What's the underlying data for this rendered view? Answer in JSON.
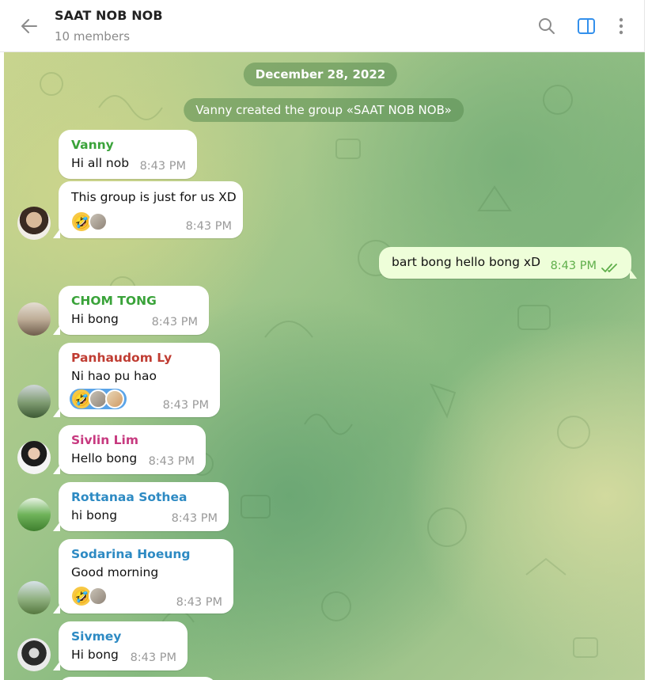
{
  "header": {
    "title": "SAAT NOB NOB",
    "subtitle": "10 members"
  },
  "chat": {
    "date_pill": "December 28, 2022",
    "service_message": "Vanny created the group «SAAT NOB NOB»",
    "messages": [
      {
        "sender": "Vanny",
        "sender_color": "#3aa33a",
        "text": "Hi all nob",
        "time": "8:43 PM"
      },
      {
        "sender": "",
        "text": "This group is just for us XD",
        "time": "8:43 PM",
        "reaction_emoji": "🤣"
      },
      {
        "sender": "",
        "text": "bart bong hello bong xD",
        "time": "8:43 PM",
        "outgoing": true
      },
      {
        "sender": "CHOM TONG",
        "sender_color": "#3aa33a",
        "text": "Hi bong",
        "time": "8:43 PM"
      },
      {
        "sender": "Panhaudom Ly",
        "sender_color": "#c03d33",
        "text": "Ni hao pu hao",
        "time": "8:43 PM",
        "reaction_emoji": "🤣"
      },
      {
        "sender": "Sivlin Lim",
        "sender_color": "#c7397f",
        "text": "Hello bong",
        "time": "8:43 PM"
      },
      {
        "sender": "Rottanaa Sothea",
        "sender_color": "#2d8ac3",
        "text": "hi bong",
        "time": "8:43 PM"
      },
      {
        "sender": "Sodarina Hoeung",
        "sender_color": "#2d8ac3",
        "text": "Good morning",
        "time": "8:43 PM",
        "reaction_emoji": "🤣"
      },
      {
        "sender": "Sivmey",
        "sender_color": "#2d8ac3",
        "text": "Hi bong",
        "time": "8:43 PM"
      }
    ]
  },
  "colors": {
    "accent": "#3390ec",
    "outgoing_bubble": "#eefed9",
    "read_check": "#5fae4b"
  }
}
